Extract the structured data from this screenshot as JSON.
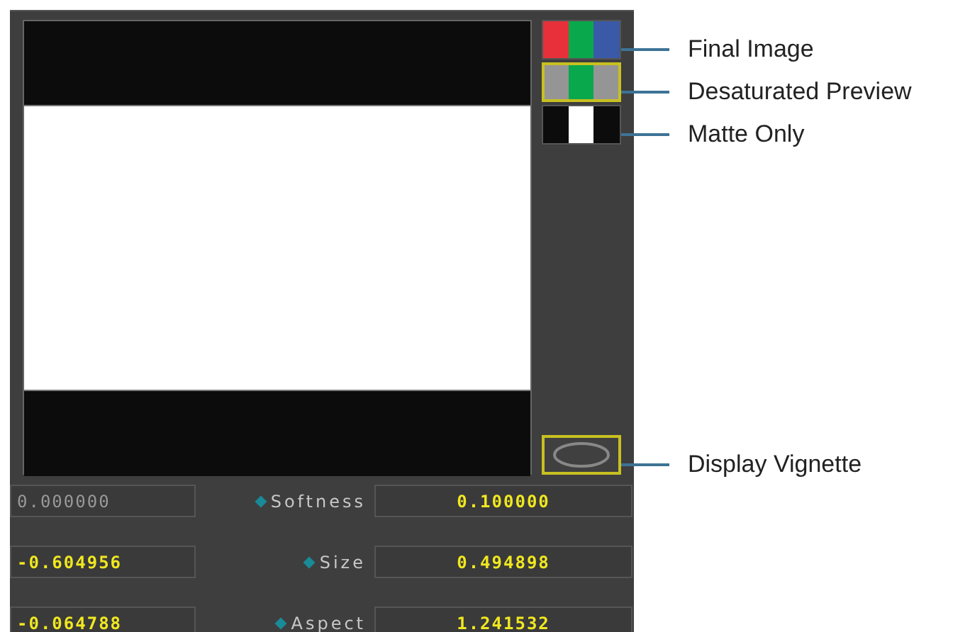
{
  "modes": [
    {
      "label": "Final Image",
      "kind": "rgb",
      "selected": false
    },
    {
      "label": "Desaturated Preview",
      "kind": "desat",
      "selected": true
    },
    {
      "label": "Matte Only",
      "kind": "matte",
      "selected": false
    }
  ],
  "vignette": {
    "label": "Display Vignette",
    "on": true
  },
  "params": [
    {
      "left": {
        "value": "0.000000",
        "disabled": true
      },
      "label": "Softness",
      "value": "0.100000"
    },
    {
      "left": {
        "value": "-0.604956",
        "disabled": false
      },
      "label": "Size",
      "value": "0.494898"
    },
    {
      "left": {
        "value": "-0.064788",
        "disabled": false
      },
      "label": "Aspect",
      "value": "1.241532"
    }
  ]
}
